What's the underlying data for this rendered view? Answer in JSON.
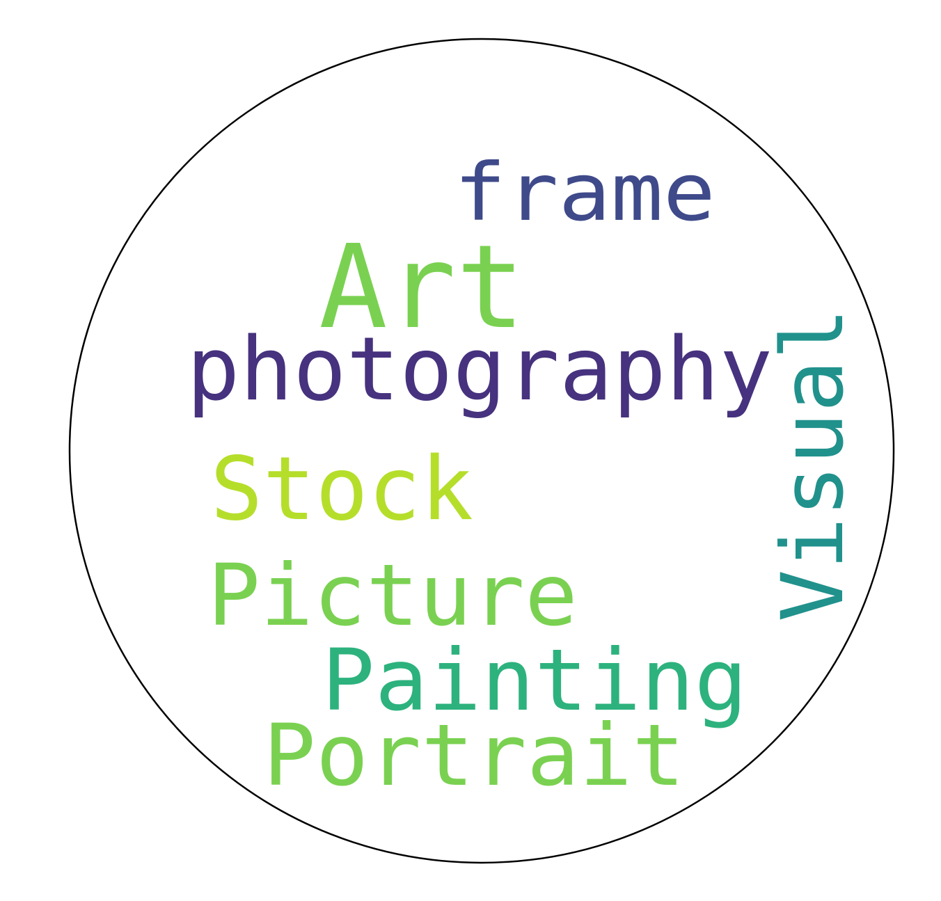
{
  "word_cloud": {
    "words": [
      {
        "text": "frame",
        "color": "#3f4a8a"
      },
      {
        "text": "Art",
        "color": "#7ad151"
      },
      {
        "text": "photography",
        "color": "#46327e"
      },
      {
        "text": "Visual",
        "color": "#21918c"
      },
      {
        "text": "Stock",
        "color": "#b5de2b"
      },
      {
        "text": "Picture",
        "color": "#7ad151"
      },
      {
        "text": "Painting",
        "color": "#2db27d"
      },
      {
        "text": "Portrait",
        "color": "#7ad151"
      }
    ],
    "mask_shape": "circle",
    "outline_color": "#000000",
    "background_color": "#ffffff"
  }
}
